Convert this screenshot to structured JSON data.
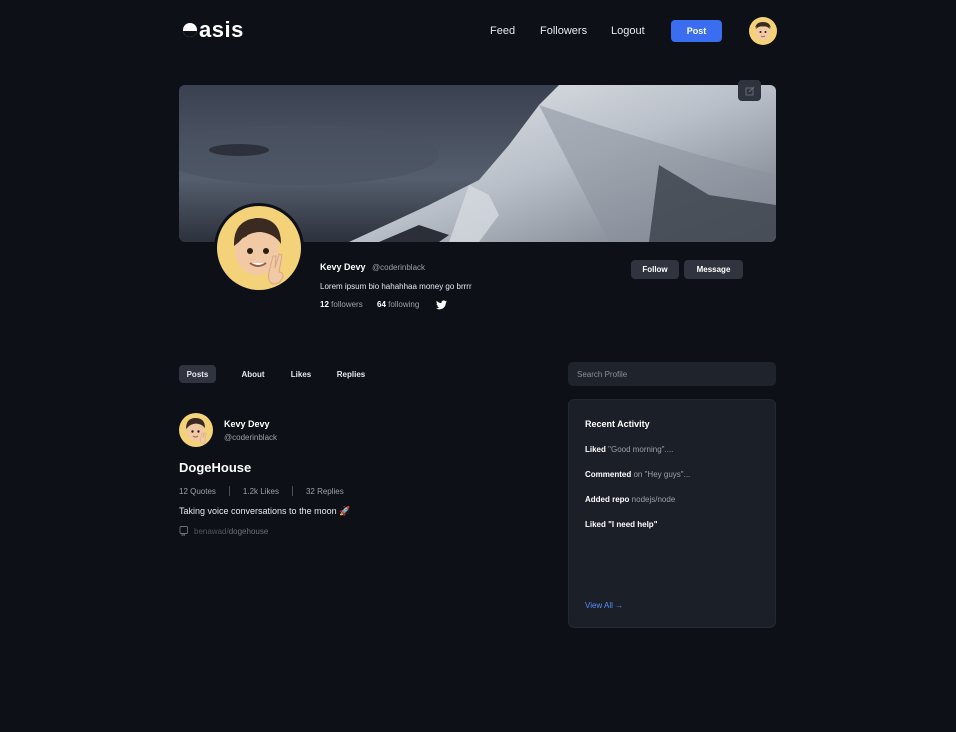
{
  "header": {
    "logo_text": "asis",
    "nav": [
      "Feed",
      "Followers",
      "Logout"
    ],
    "post_label": "Post"
  },
  "profile": {
    "name": "Kevy Devy",
    "handle": "@coderinblack",
    "bio": "Lorem ipsum bio hahahhaa money go brrrr",
    "followers_count": "12",
    "followers_label": "followers",
    "following_count": "64",
    "following_label": "following",
    "follow_label": "Follow",
    "message_label": "Message"
  },
  "tabs": [
    "Posts",
    "About",
    "Likes",
    "Replies"
  ],
  "search": {
    "placeholder": "Search Profile"
  },
  "post": {
    "author": "Kevy Devy",
    "handle": "@coderinblack",
    "title": "DogeHouse",
    "quotes": "12 Quotes",
    "likes": "1.2k Likes",
    "replies": "32 Replies",
    "body": "Taking voice conversations to the moon 🚀",
    "repo_owner": "benawad/",
    "repo_name": "dogehouse"
  },
  "activity": {
    "title": "Recent Activity",
    "items": [
      {
        "verb": "Liked",
        "rest": " \"Good morning\"...."
      },
      {
        "verb": "Commented",
        "rest": " on \"Hey guys\"..."
      },
      {
        "verb": "Added repo",
        "rest": " nodejs/node"
      },
      {
        "verb": "Liked \"I need help\"",
        "rest": ""
      }
    ],
    "view_all": "View All →"
  },
  "colors": {
    "background": "#0d1017",
    "accent": "#3a6df0",
    "card": "#1b1f27",
    "link": "#5a8bff"
  }
}
